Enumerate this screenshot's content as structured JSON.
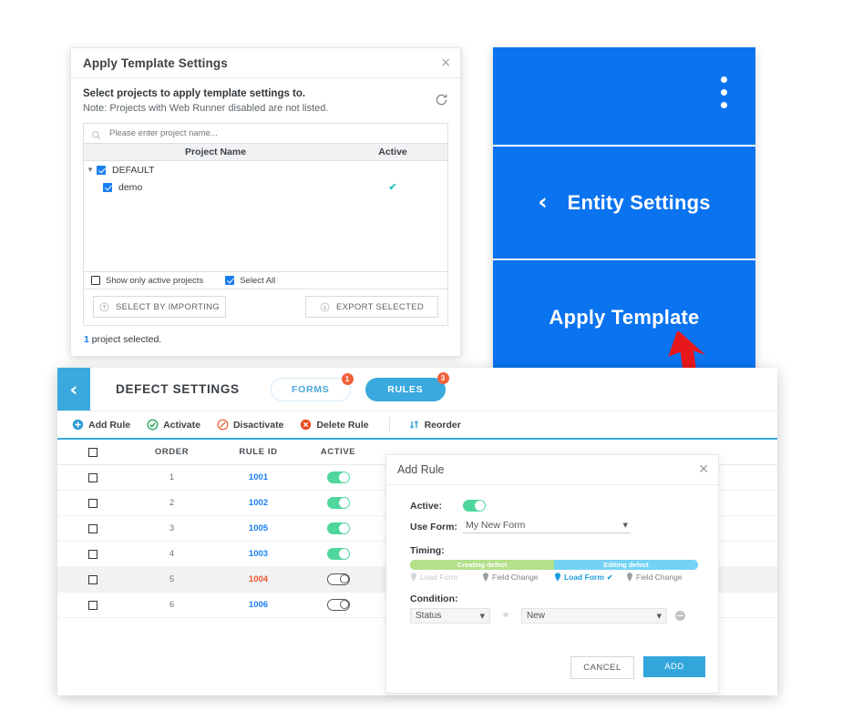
{
  "apply_dialog": {
    "title": "Apply Template Settings",
    "close_label": "×",
    "lead": "Select projects to apply template settings to.",
    "note": "Note: Projects with Web Runner disabled are not listed.",
    "search_placeholder": "Please enter project name...",
    "search_value": "",
    "columns": {
      "name": "Project Name",
      "active": "Active"
    },
    "tree": [
      {
        "label": "DEFAULT",
        "checked": true,
        "expanded": true,
        "active": "",
        "child": false
      },
      {
        "label": "demo",
        "checked": true,
        "expanded": false,
        "active": "✔",
        "child": true
      }
    ],
    "options": {
      "show_active_label": "Show only active projects",
      "show_active_checked": false,
      "select_all_label": "Select All",
      "select_all_checked": true
    },
    "buttons": {
      "import": "SELECT BY IMPORTING",
      "export": "EXPORT SELECTED"
    },
    "selection_count": "1",
    "selection_text": " project selected."
  },
  "blue_panel": {
    "background": "#0a73ef",
    "menu_icon": "kebab-menu-icon",
    "entity_settings": "Entity Settings",
    "apply_template": "Apply Template",
    "back_glyph": "‹"
  },
  "defect_panel": {
    "back_glyph": "‹",
    "title": "DEFECT SETTINGS",
    "tabs": [
      {
        "label": "FORMS",
        "badge": "1",
        "selected": false
      },
      {
        "label": "RULES",
        "badge": "3",
        "selected": true
      }
    ],
    "toolbar": [
      {
        "label": "Add Rule",
        "icon": "plus-circle-icon"
      },
      {
        "label": "Activate",
        "icon": "activate-icon"
      },
      {
        "label": "Disactivate",
        "icon": "disactivate-icon"
      },
      {
        "label": "Delete Rule",
        "icon": "delete-circle-icon"
      },
      {
        "label": "Reorder",
        "icon": "reorder-icon"
      }
    ],
    "table": {
      "columns": [
        "",
        "ORDER",
        "RULE ID",
        "ACTIVE"
      ],
      "rows": [
        {
          "checked": false,
          "order": "1",
          "rule_id": "1001",
          "active": true,
          "warn": false,
          "alt": false
        },
        {
          "checked": false,
          "order": "2",
          "rule_id": "1002",
          "active": true,
          "warn": false,
          "alt": false
        },
        {
          "checked": false,
          "order": "3",
          "rule_id": "1005",
          "active": true,
          "warn": false,
          "alt": false
        },
        {
          "checked": false,
          "order": "4",
          "rule_id": "1003",
          "active": true,
          "warn": false,
          "alt": false
        },
        {
          "checked": false,
          "order": "5",
          "rule_id": "1004",
          "active": false,
          "warn": true,
          "alt": true
        },
        {
          "checked": false,
          "order": "6",
          "rule_id": "1006",
          "active": false,
          "warn": false,
          "alt": false
        }
      ]
    }
  },
  "add_rule_dialog": {
    "title": "Add Rule",
    "close_label": "✕",
    "active_label": "Active:",
    "active_on": true,
    "use_form_label": "Use Form:",
    "use_form_value": "My New Form",
    "timing_label": "Timing:",
    "timing_segments": [
      {
        "label": "Creating defect",
        "color": "#b4e08a"
      },
      {
        "label": "Editing defect",
        "color": "#74d2f4"
      }
    ],
    "timing_options": [
      {
        "label": "Load Form",
        "state": "dim"
      },
      {
        "label": "Field Change",
        "state": "normal"
      },
      {
        "label": "Load Form",
        "state": "selected",
        "tick": "✔"
      },
      {
        "label": "Field Change",
        "state": "normal"
      }
    ],
    "condition_label": "Condition:",
    "condition": {
      "field": "Status",
      "operator": "=",
      "value": "New"
    },
    "cancel_label": "CANCEL",
    "add_label": "ADD"
  }
}
